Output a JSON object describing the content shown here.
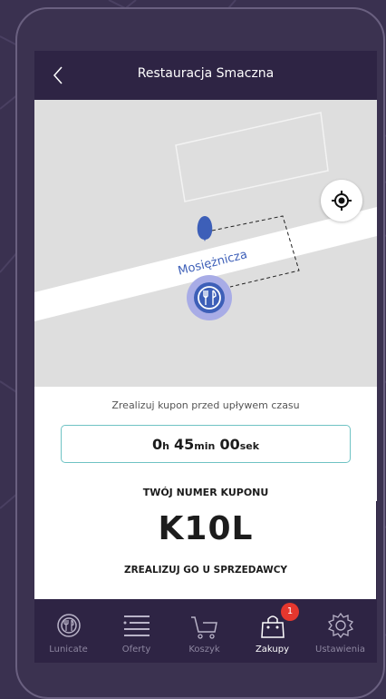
{
  "header": {
    "title": "Restauracja Smaczna"
  },
  "map": {
    "street_name": "Mosiężnicza"
  },
  "timer": {
    "hint": "Zrealizuj kupon przed upływem czasu",
    "hours": "0",
    "hours_unit": "h",
    "minutes": "45",
    "minutes_unit": "min",
    "seconds": "00",
    "seconds_unit": "sek"
  },
  "coupon": {
    "label": "TWÓJ NUMER KUPONU",
    "code": "K10L",
    "redeem_text": "ZREALIZUJ GO U SPRZEDAWCY"
  },
  "tabs": [
    {
      "label": "Lunicate",
      "icon": "restaurant-icon"
    },
    {
      "label": "Oferty",
      "icon": "list-icon"
    },
    {
      "label": "Koszyk",
      "icon": "cart-icon"
    },
    {
      "label": "Zakupy",
      "icon": "bag-icon",
      "badge": "1",
      "active": true
    },
    {
      "label": "Ustawienia",
      "icon": "gear-icon"
    }
  ],
  "colors": {
    "header_bg": "#2e2444",
    "accent": "#6fc3c4",
    "pin": "#3d5fb8",
    "badge": "#e5372e"
  }
}
